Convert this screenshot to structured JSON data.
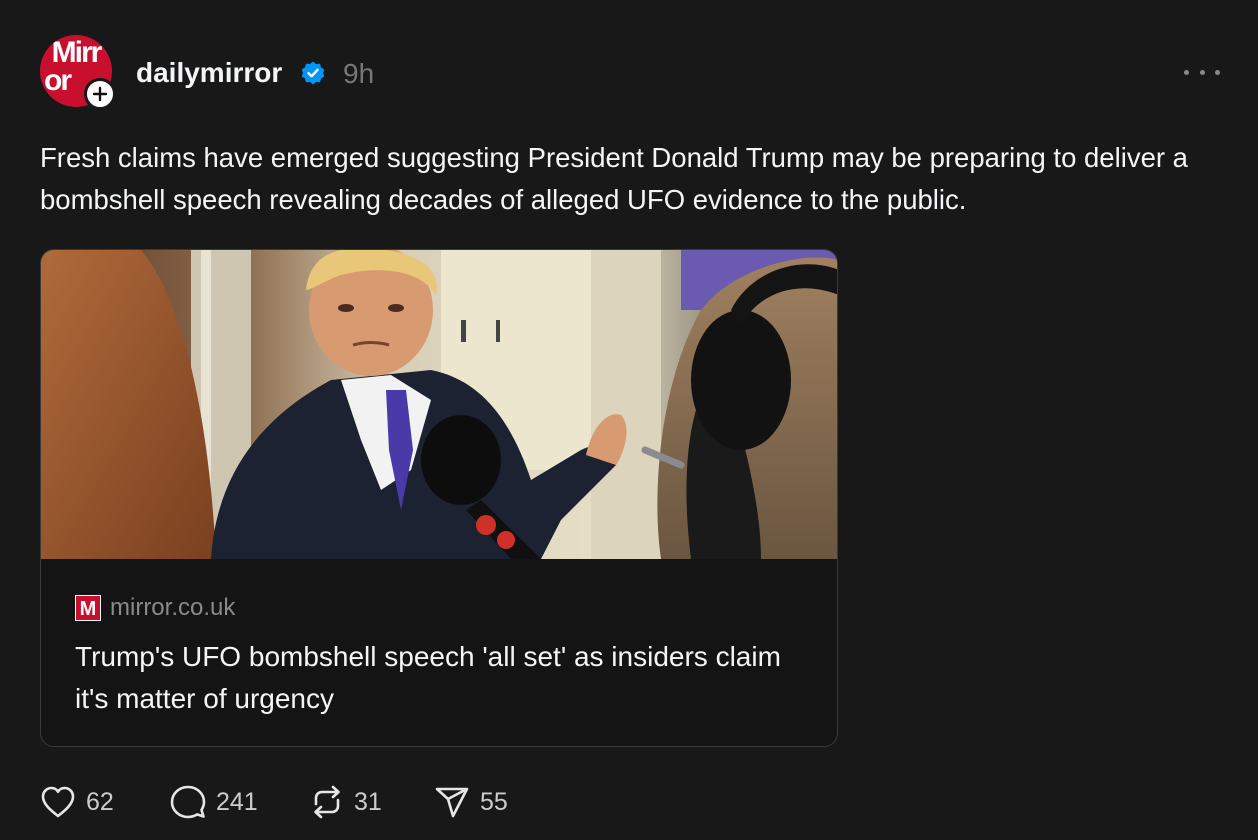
{
  "post": {
    "avatar": {
      "logo_text": "Mirr\nor",
      "icon": "mirror-logo-avatar",
      "brand_color": "#c8102e"
    },
    "follow_icon": "plus-icon",
    "username": "dailymirror",
    "verified_icon": "verified-badge-icon",
    "verified_color": "#0095f6",
    "time": "9h",
    "more_icon": "more-horizontal-icon",
    "text": "Fresh claims have emerged suggesting President Donald Trump may be preparing to deliver a bombshell speech revealing decades of alleged UFO evidence to the public."
  },
  "link_card": {
    "image": "photo-trump-speaking-to-press-aboard-plane",
    "favicon_letter": "M",
    "domain": "mirror.co.uk",
    "title": "Trump's UFO bombshell speech 'all set' as insiders claim it's matter of urgency"
  },
  "actions": {
    "like": {
      "icon": "heart-icon",
      "count": "62"
    },
    "reply": {
      "icon": "comment-icon",
      "count": "241"
    },
    "repost": {
      "icon": "repost-icon",
      "count": "31"
    },
    "share": {
      "icon": "send-icon",
      "count": "55"
    }
  }
}
